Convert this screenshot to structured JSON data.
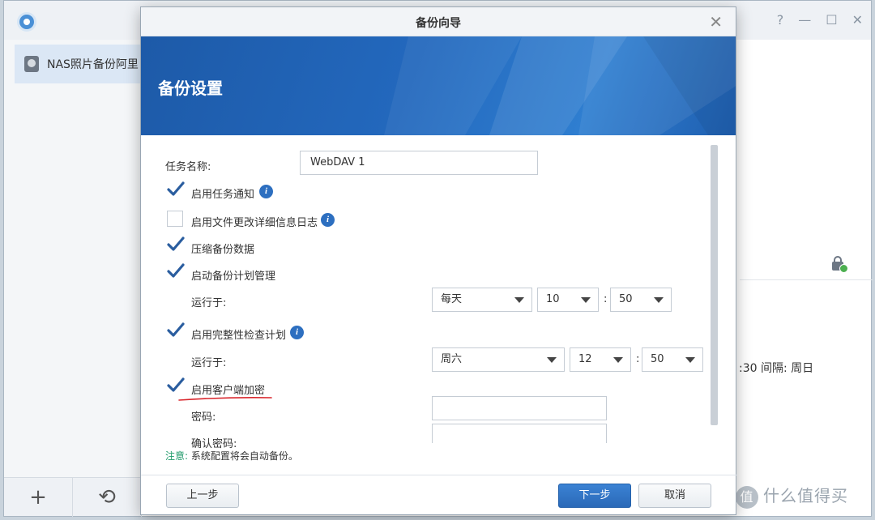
{
  "app": {
    "task_name": "NAS照片备份阿里",
    "schedule_text": ":30 间隔: 周日",
    "window_controls": [
      "?",
      "—",
      "☐",
      "✕"
    ],
    "bottom_buttons": [
      {
        "icon": "plus-icon",
        "glyph": "+"
      },
      {
        "icon": "restore-history-icon",
        "glyph": "⟲"
      }
    ],
    "watermark": "什么值得买",
    "watermark_badge": "值"
  },
  "dialog": {
    "title": "备份向导",
    "close_glyph": "✕",
    "banner_title": "备份设置",
    "task_name_label": "任务名称:",
    "task_name_value": "WebDAV 1",
    "options": {
      "task_notify": {
        "label": "启用任务通知",
        "checked": true
      },
      "change_log": {
        "label": "启用文件更改详细信息日志",
        "checked": false
      },
      "compress": {
        "label": "压缩备份数据",
        "checked": true
      },
      "schedule": {
        "label": "启动备份计划管理",
        "checked": true
      },
      "integrity": {
        "label": "启用完整性检查计划",
        "checked": true
      },
      "encryption": {
        "label": "启用客户端加密",
        "checked": true
      }
    },
    "schedule_run": {
      "label": "运行于:",
      "frequency": "每天",
      "hour": "10",
      "minute": "50"
    },
    "integrity_run": {
      "label": "运行于:",
      "frequency": "周六",
      "hour": "12",
      "minute": "50"
    },
    "password_label": "密码:",
    "password_value": "",
    "confirm_password_label": "确认密码:",
    "confirm_password_value": "",
    "time_separator": ":",
    "note_label": "注意:",
    "note_text": "系统配置将会自动备份。",
    "buttons": {
      "back": "上一步",
      "next": "下一步",
      "cancel": "取消"
    }
  },
  "colors": {
    "accent": "#2a69b8",
    "banner": "#2368bd",
    "note_label": "#1f9a6a",
    "annotation_underline": "#d9262c"
  }
}
